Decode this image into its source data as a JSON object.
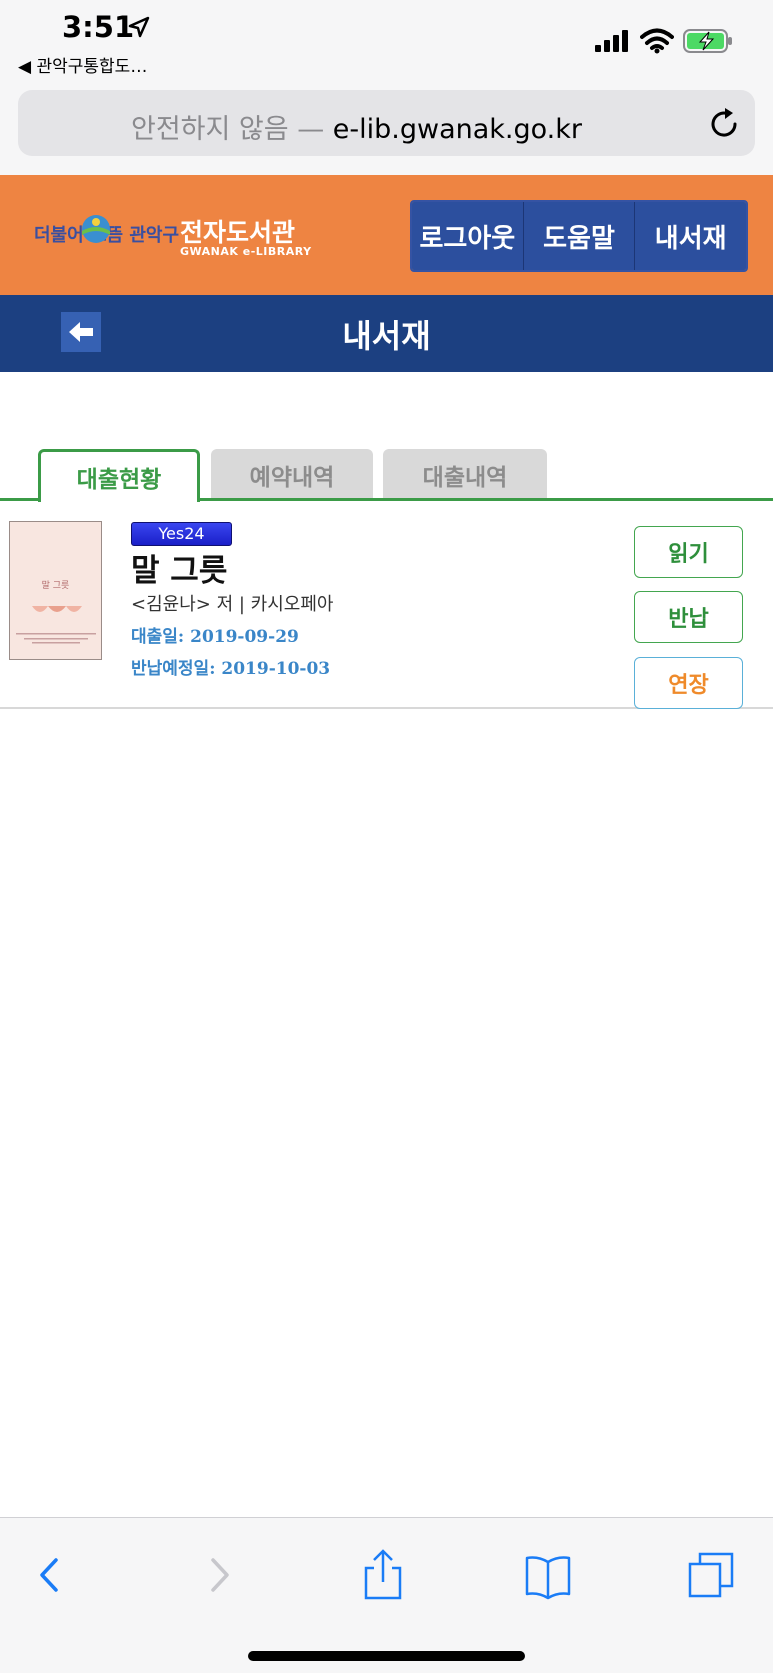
{
  "status_bar": {
    "time": "3:51",
    "back_app": "◀ 관악구통합도…"
  },
  "browser": {
    "insecure_label": "안전하지 않음",
    "separator": " — ",
    "domain": "e-lib.gwanak.go.kr"
  },
  "header": {
    "logo_slogan": "더불어 으뜸 관악구",
    "logo_title": "전자도서관",
    "logo_sub": "GWANAK e-LIBRARY",
    "buttons": [
      "로그아웃",
      "도움말",
      "내서재"
    ]
  },
  "title_bar": {
    "title": "내서재"
  },
  "tabs": [
    {
      "label": "대출현황",
      "active": true
    },
    {
      "label": "예약내역",
      "active": false
    },
    {
      "label": "대출내역",
      "active": false
    }
  ],
  "books": [
    {
      "vendor": "Yes24",
      "title": "말 그릇",
      "author": "<김윤나> 저 | 카시오페아",
      "loan_date": "대출일: 2019-09-29",
      "due_date": "반납예정일: 2019-10-03",
      "cover_title": "말 그릇",
      "actions": {
        "read": "읽기",
        "return": "반납",
        "extend": "연장"
      }
    }
  ],
  "colors": {
    "header_orange": "#ee8442",
    "nav_blue": "#1c4081",
    "button_blue": "#2c4f9e",
    "tab_green": "#3b9b47",
    "date_blue": "#3a86c8",
    "extend_orange": "#ef8a2a"
  },
  "icons": {
    "back": "arrow-left-icon",
    "reload": "reload-icon",
    "toolbar": [
      "chevron-left-icon",
      "chevron-right-icon",
      "share-icon",
      "bookmarks-icon",
      "tabs-icon"
    ]
  }
}
